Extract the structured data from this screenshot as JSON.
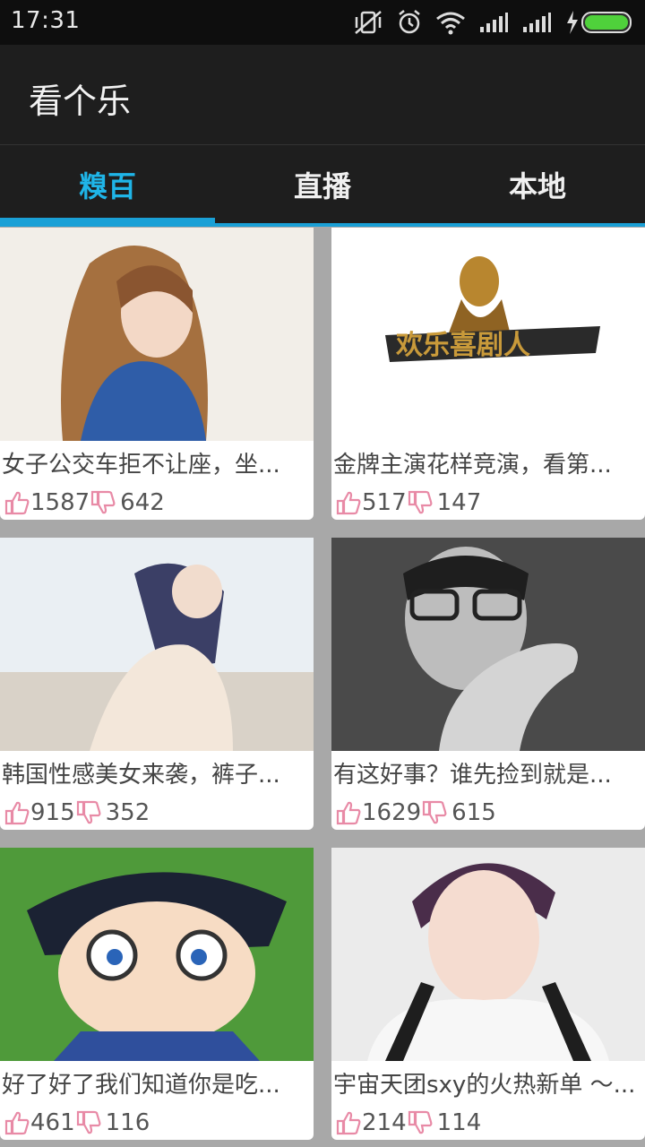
{
  "status": {
    "time": "17:31"
  },
  "app": {
    "title": "看个乐"
  },
  "tabs": [
    {
      "label": "糗百"
    },
    {
      "label": "直播"
    },
    {
      "label": "本地"
    }
  ],
  "cards": [
    {
      "caption": "女子公交车拒不让座，坐...",
      "likes": "1587",
      "dislikes": "642"
    },
    {
      "caption": "金牌主演花样竞演，看第...",
      "likes": "517",
      "dislikes": "147",
      "thumb_text": "欢乐喜剧人"
    },
    {
      "caption": "韩国性感美女来袭，裤子...",
      "likes": "915",
      "dislikes": "352"
    },
    {
      "caption": "有这好事？谁先捡到就是...",
      "likes": "1629",
      "dislikes": "615"
    },
    {
      "caption": "好了好了我们知道你是吃...",
      "likes": "461",
      "dislikes": "116"
    },
    {
      "caption": "宇宙天团sxy的火热新单 ～...",
      "likes": "214",
      "dislikes": "114"
    }
  ],
  "colors": {
    "accent": "#1aa0d6",
    "active_tab": "#1fb5e8",
    "thumb_icon": "#e88aa6"
  }
}
